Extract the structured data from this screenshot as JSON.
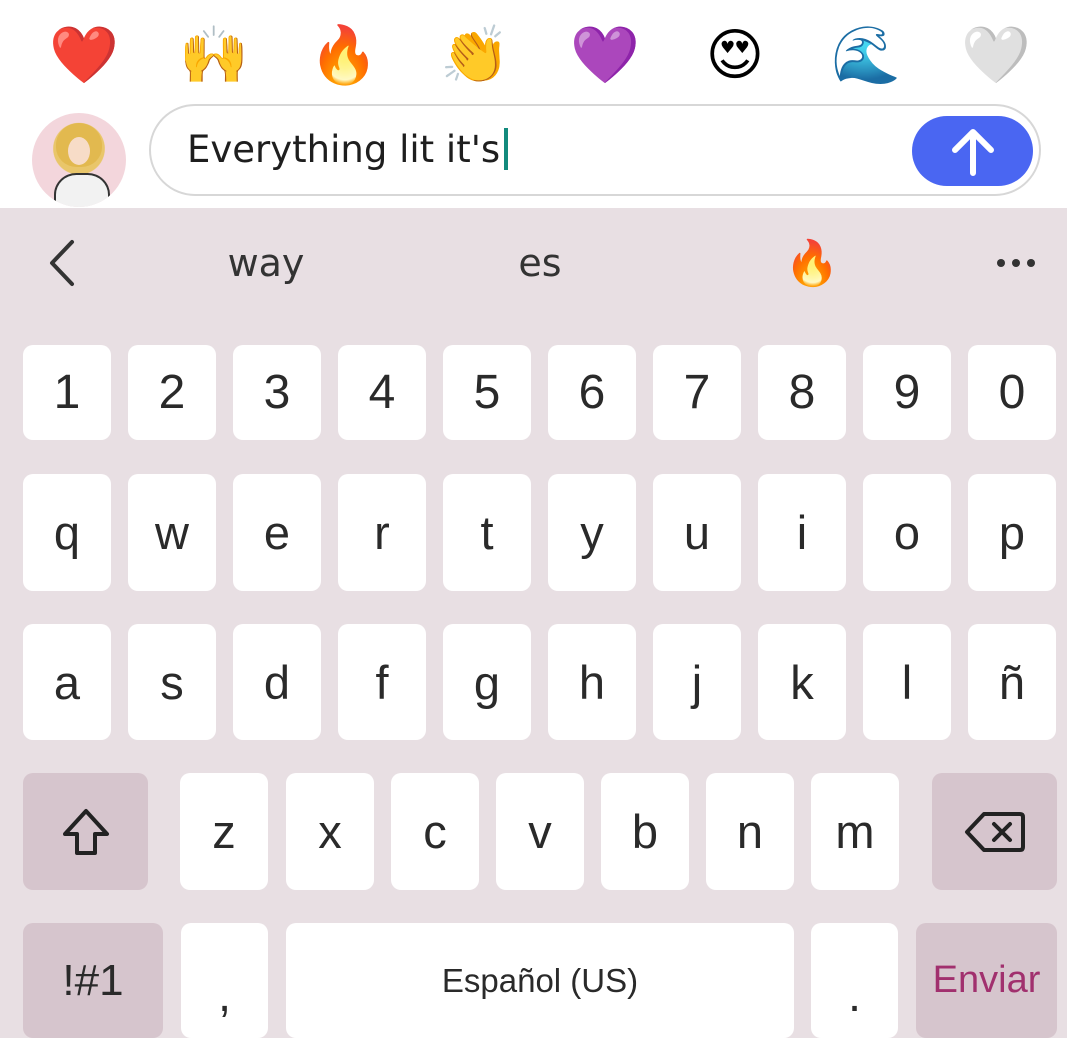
{
  "emoji_bar": [
    "❤️",
    "🙌",
    "🔥",
    "👏",
    "💜",
    "😍",
    "🌊",
    "🤍"
  ],
  "composer": {
    "text": "Everything lit it's",
    "send_icon": "arrow-up-icon",
    "avatar_icon": "profile-avatar"
  },
  "suggestions": {
    "back_icon": "chevron-left-icon",
    "items": [
      "way",
      "es",
      "🔥"
    ],
    "more_icon": "more-dots-icon"
  },
  "keyboard": {
    "numbers": [
      "1",
      "2",
      "3",
      "4",
      "5",
      "6",
      "7",
      "8",
      "9",
      "0"
    ],
    "row1": [
      "q",
      "w",
      "e",
      "r",
      "t",
      "y",
      "u",
      "i",
      "o",
      "p"
    ],
    "row2": [
      "a",
      "s",
      "d",
      "f",
      "g",
      "h",
      "j",
      "k",
      "l",
      "ñ"
    ],
    "row3": [
      "z",
      "x",
      "c",
      "v",
      "b",
      "n",
      "m"
    ],
    "shift_icon": "shift-icon",
    "backspace_icon": "backspace-icon",
    "symbols_label": "!#1",
    "comma_label": ",",
    "space_label": "Español (US)",
    "period_label": ".",
    "enter_label": "Enviar",
    "enter_color": "#a1306e"
  },
  "colors": {
    "accent": "#4a66f2",
    "keyboard_bg": "#e8dfe3",
    "modifier_key": "#d6c5cd",
    "caret": "#128a7d"
  }
}
